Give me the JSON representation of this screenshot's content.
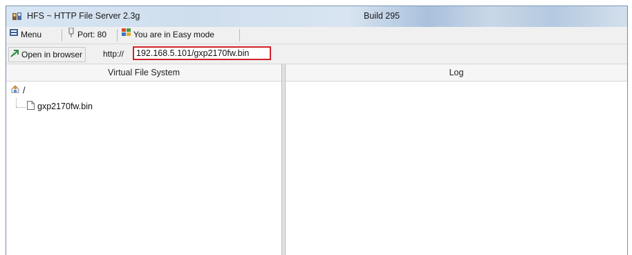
{
  "window": {
    "title": "HFS ~ HTTP File Server 2.3g",
    "build": "Build 295"
  },
  "toolbar": {
    "menu_label": "Menu",
    "port_label": "Port: 80",
    "mode_label": "You are in Easy mode"
  },
  "address": {
    "open_label": "Open in browser",
    "url_prefix": "http://",
    "url_value": "192.168.5.101/gxp2170fw.bin"
  },
  "panels": {
    "vfs_title": "Virtual File System",
    "log_title": "Log"
  },
  "tree": {
    "root_label": "/",
    "items": [
      {
        "label": "gxp2170fw.bin",
        "icon": "file-icon"
      }
    ]
  },
  "icons": {
    "app": "hfs-app-icon",
    "menu": "menu-icon",
    "port": "port-icon",
    "mode": "easy-mode-icon",
    "open": "open-browser-icon",
    "root": "root-folder-icon",
    "file": "file-icon"
  },
  "colors": {
    "highlight_border": "#d0202a",
    "window_border": "#6f8aa8"
  }
}
